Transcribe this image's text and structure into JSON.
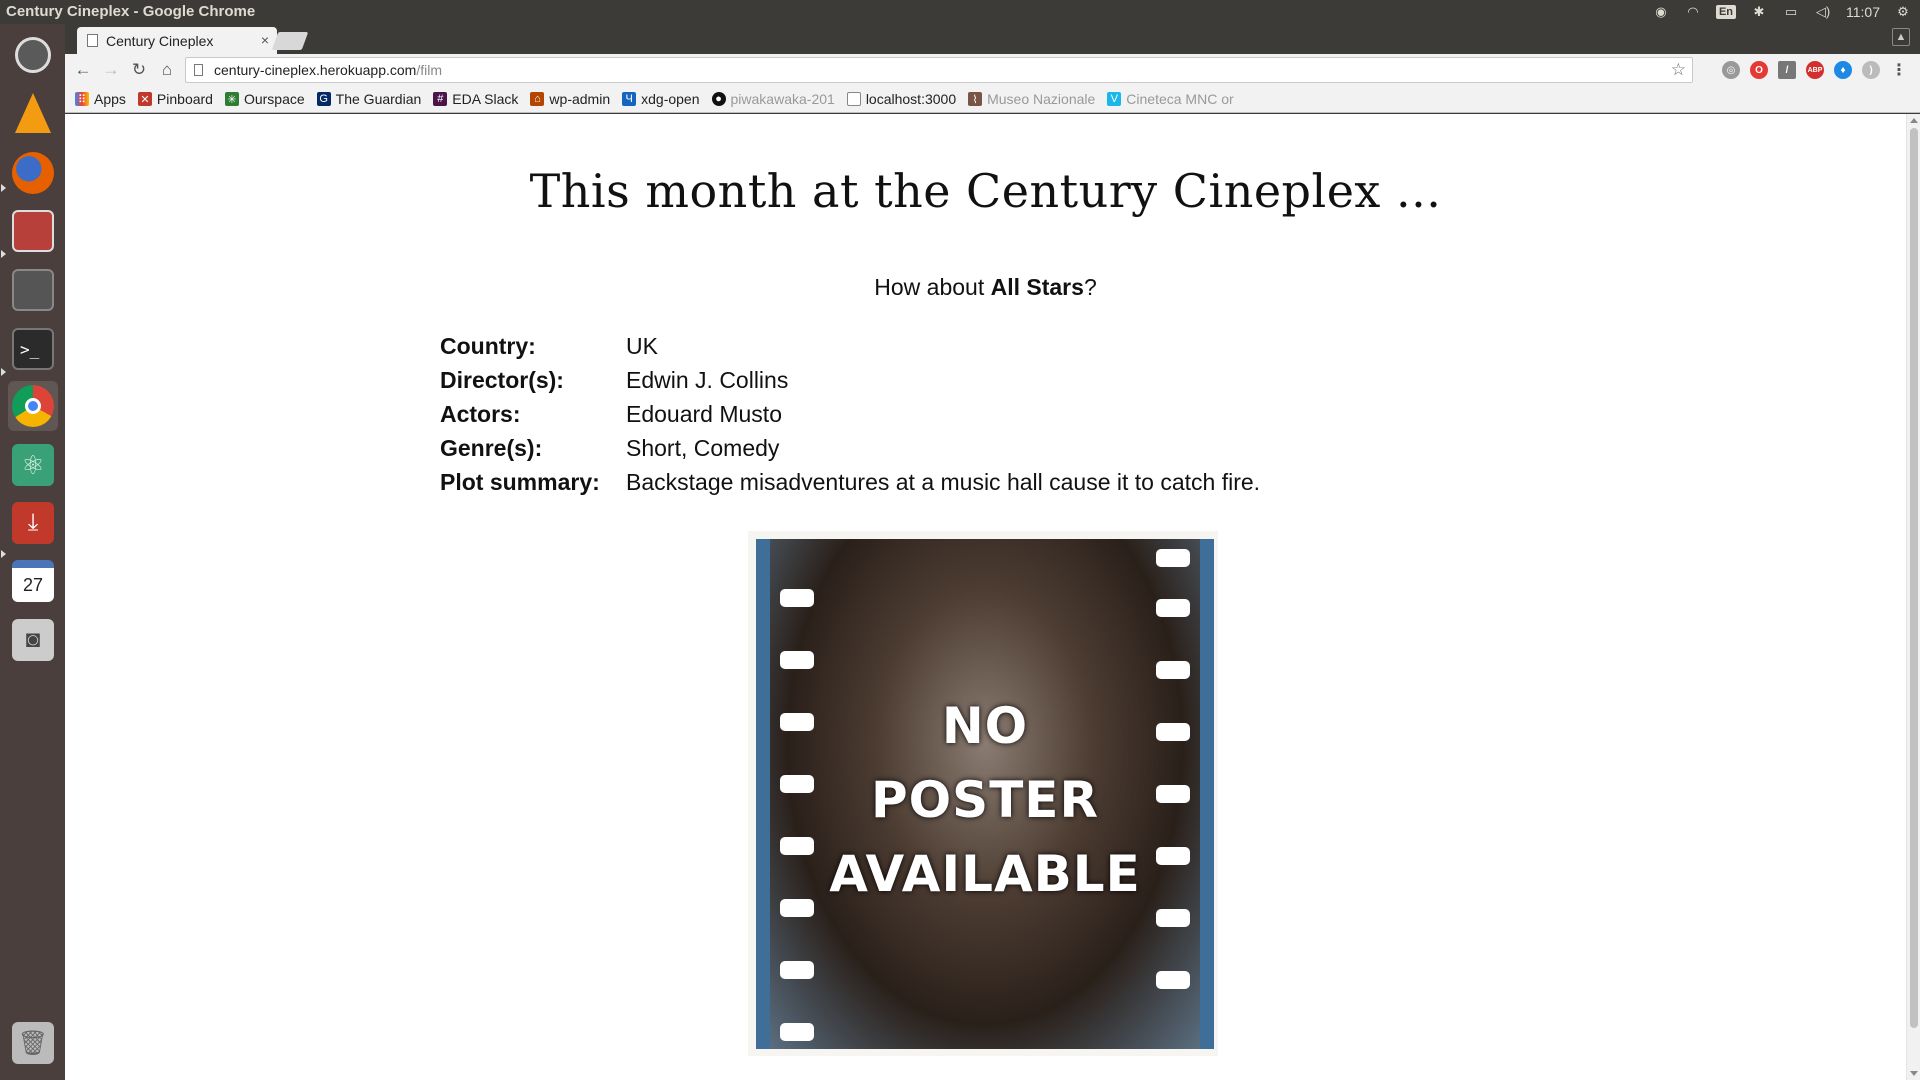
{
  "window": {
    "title": "Century Cineplex - Google Chrome"
  },
  "tray": {
    "lang": "En",
    "clock": "11:07"
  },
  "launcher": {
    "items": [
      "ubuntu-dash",
      "vlc",
      "firefox",
      "files",
      "calculator",
      "terminal",
      "chrome",
      "atom",
      "installer",
      "calendar",
      "camera",
      "trash"
    ],
    "calendar_day": "27"
  },
  "tab": {
    "title": "Century Cineplex",
    "close": "×"
  },
  "address": {
    "host": "century-cineplex.herokuapp.com",
    "path": "/film"
  },
  "bookmarks": [
    {
      "label": "Apps",
      "icon": "apps-grid-icon",
      "color": "#4285f4"
    },
    {
      "label": "Pinboard",
      "icon": "pinboard-icon",
      "color": "#c0392b"
    },
    {
      "label": "Ourspace",
      "icon": "ourspace-icon",
      "color": "#2e7d32"
    },
    {
      "label": "The Guardian",
      "icon": "guardian-icon",
      "color": "#052962"
    },
    {
      "label": "EDA Slack",
      "icon": "slack-icon",
      "color": "#4a154b"
    },
    {
      "label": "wp-admin",
      "icon": "wp-admin-icon",
      "color": "#b34700"
    },
    {
      "label": "xdg-open",
      "icon": "xdg-open-icon",
      "color": "#1565c0"
    },
    {
      "label": "piwakawaka-201",
      "icon": "github-icon",
      "color": "#111111"
    },
    {
      "label": "localhost:3000",
      "icon": "page-icon",
      "color": "#888888"
    },
    {
      "label": "Museo Nazionale",
      "icon": "museo-icon",
      "color": "#795548"
    },
    {
      "label": "Cineteca MNC or",
      "icon": "vimeo-icon",
      "color": "#1ab7ea"
    }
  ],
  "page": {
    "heading": "This month at the Century Cineplex ...",
    "suggest_prefix": "How about ",
    "film_title": "All Stars",
    "suggest_suffix": "?",
    "details": [
      {
        "label": "Country:",
        "value": "UK"
      },
      {
        "label": "Director(s):",
        "value": "Edwin J. Collins"
      },
      {
        "label": "Actors:",
        "value": "Edouard Musto"
      },
      {
        "label": "Genre(s):",
        "value": "Short, Comedy"
      },
      {
        "label": "Plot summary:",
        "value": "Backstage misadventures at a music hall cause it to catch fire."
      }
    ],
    "poster": {
      "line1": "NO",
      "line2": "POSTER",
      "line3": "AVAILABLE"
    }
  }
}
